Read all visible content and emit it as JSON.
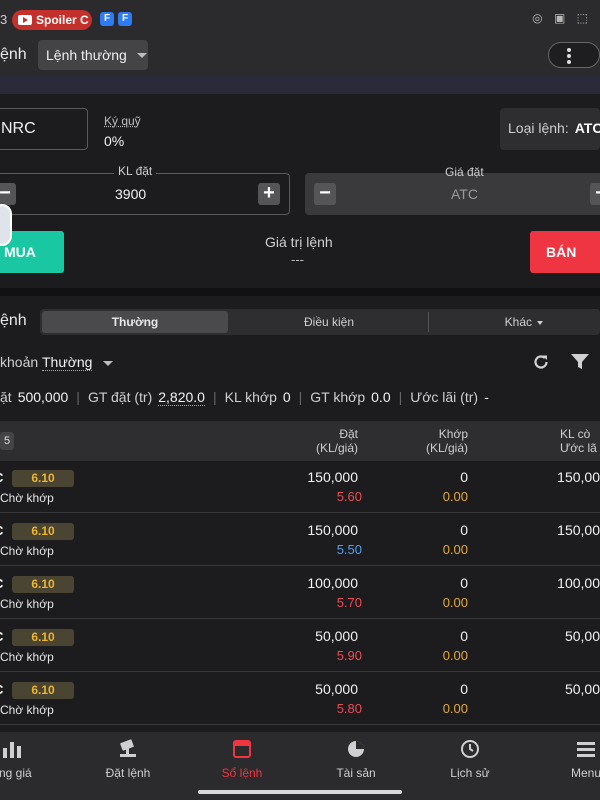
{
  "status_bar": {
    "number": "3",
    "pill_label": "Spoiler C",
    "app_icon_1": "F",
    "app_icon_2": "F",
    "right_icons": "◎ ▣ ⬚"
  },
  "header": {
    "title": "ệnh",
    "order_type": "Lệnh thường"
  },
  "form": {
    "symbol": "NRC",
    "margin_label": "Ký quỹ",
    "margin_value": "0%",
    "order_kind_label": "Loại lệnh:",
    "order_kind_value": "ATC",
    "quantity_label": "KL đặt",
    "quantity_value": "3900",
    "price_label": "Giá đặt",
    "price_value": "ATC",
    "buy_label": "MUA",
    "sell_label": "BÁN",
    "order_value_label": "Giá trị lệnh",
    "order_value": "---"
  },
  "orders": {
    "section_title": "ệnh",
    "tabs": [
      "Thường",
      "Điều kiện",
      "Khác"
    ],
    "account_label": "khoản",
    "account_value": "Thường",
    "summary": {
      "kl_dat_label": "ặt",
      "kl_dat_value": "500,000",
      "gt_dat_label": "GT đặt (tr)",
      "gt_dat_value": "2,820.0",
      "kl_khop_label": "KL khớp",
      "kl_khop_value": "0",
      "gt_khop_label": "GT khớp",
      "gt_khop_value": "0.0",
      "uoc_lai_label": "Ước lãi (tr)",
      "uoc_lai_value": "-"
    },
    "count": "5",
    "columns": {
      "dat_1": "Đặt",
      "dat_2": "(KL/giá)",
      "khop_1": "Khớp",
      "khop_2": "(KL/giá)",
      "klcon_1": "KL cò",
      "klcon_2": "Ước lã"
    },
    "rows": [
      {
        "code": "C",
        "badge": "6.10",
        "status": "Chờ khớp",
        "dat_kl": "150,000",
        "dat_gia": "5.60",
        "dat_color": "red",
        "khop_kl": "0",
        "khop_gia": "0.00",
        "kl_con": "150,00"
      },
      {
        "code": "C",
        "badge": "6.10",
        "status": "Chờ khớp",
        "dat_kl": "150,000",
        "dat_gia": "5.50",
        "dat_color": "blue",
        "khop_kl": "0",
        "khop_gia": "0.00",
        "kl_con": "150,00"
      },
      {
        "code": "C",
        "badge": "6.10",
        "status": "Chờ khớp",
        "dat_kl": "100,000",
        "dat_gia": "5.70",
        "dat_color": "red",
        "khop_kl": "0",
        "khop_gia": "0.00",
        "kl_con": "100,00"
      },
      {
        "code": "C",
        "badge": "6.10",
        "status": "Chờ khớp",
        "dat_kl": "50,000",
        "dat_gia": "5.90",
        "dat_color": "red",
        "khop_kl": "0",
        "khop_gia": "0.00",
        "kl_con": "50,00"
      },
      {
        "code": "C",
        "badge": "6.10",
        "status": "Chờ khớp",
        "dat_kl": "50,000",
        "dat_gia": "5.80",
        "dat_color": "red",
        "khop_kl": "0",
        "khop_gia": "0.00",
        "kl_con": "50,00"
      }
    ]
  },
  "bottom_nav": {
    "items": [
      {
        "label": "ảng giá",
        "icon": "bar-chart-icon"
      },
      {
        "label": "Đặt lệnh",
        "icon": "gavel-icon"
      },
      {
        "label": "Sổ lệnh",
        "icon": "order-book-icon"
      },
      {
        "label": "Tài sản",
        "icon": "pie-chart-icon"
      },
      {
        "label": "Lịch sử",
        "icon": "clock-icon"
      },
      {
        "label": "Menu",
        "icon": "menu-icon"
      }
    ]
  },
  "colors": {
    "buy": "#19c8a2",
    "sell": "#ef3442",
    "price_up": "#ef4b54",
    "price_ref": "#4aa3f2",
    "badge_text": "#f0b429",
    "active_nav": "#ef3442"
  }
}
